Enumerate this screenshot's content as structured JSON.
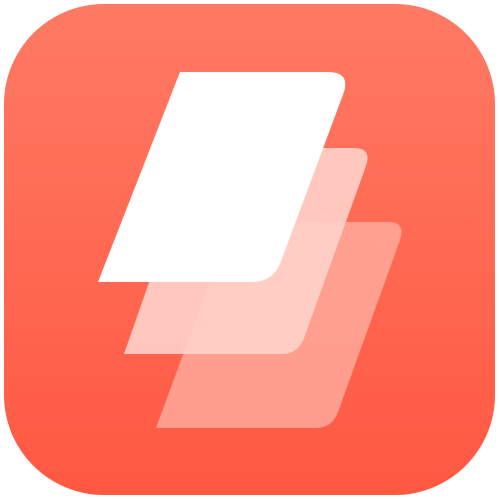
{
  "app_icon": {
    "icon": "stacked-cards-icon",
    "colors": {
      "background_top": "#ff7a63",
      "background_bottom": "#ff5842",
      "card_front": "#ffffff",
      "card_middle": "#ffd2ca",
      "card_back": "#ffa99b"
    }
  }
}
